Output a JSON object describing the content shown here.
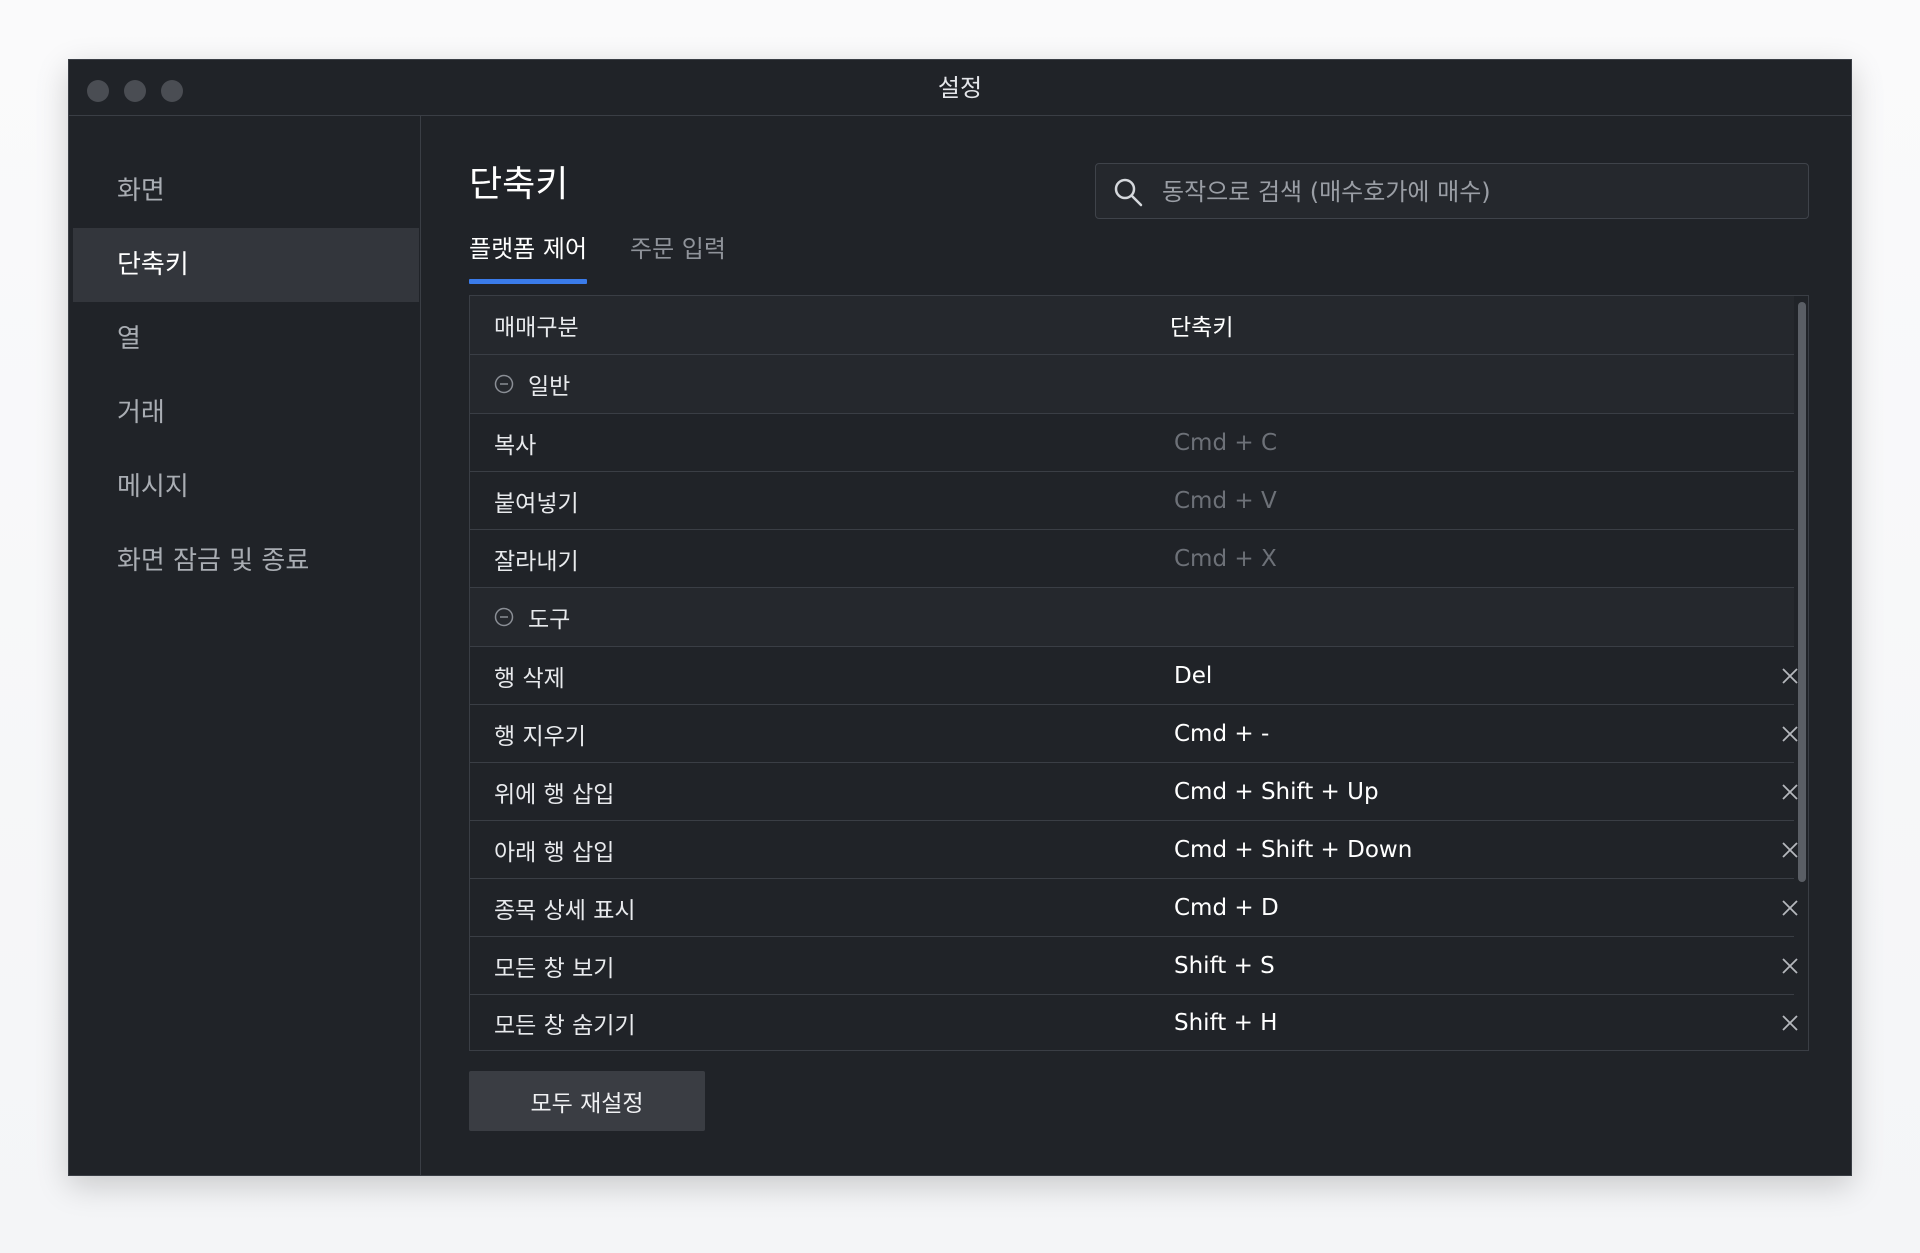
{
  "window": {
    "title": "설정"
  },
  "sidebar": {
    "items": [
      {
        "label": "화면",
        "active": false
      },
      {
        "label": "단축키",
        "active": true
      },
      {
        "label": "열",
        "active": false
      },
      {
        "label": "거래",
        "active": false
      },
      {
        "label": "메시지",
        "active": false
      },
      {
        "label": "화면 잠금 및 종료",
        "active": false
      }
    ]
  },
  "main": {
    "title": "단축키",
    "search": {
      "placeholder": "동작으로 검색 (매수호가에 매수)",
      "value": "",
      "icon": "search-icon"
    },
    "tabs": [
      {
        "label": "플랫폼 제어",
        "active": true
      },
      {
        "label": "주문 입력",
        "active": false
      }
    ],
    "table": {
      "columns": [
        "매매구분",
        "단축키"
      ],
      "groups": [
        {
          "name": "일반",
          "icon": "collapse-icon",
          "rows": [
            {
              "action": "복사",
              "shortcut": "Cmd + C",
              "editable": false
            },
            {
              "action": "붙여넣기",
              "shortcut": "Cmd + V",
              "editable": false
            },
            {
              "action": "잘라내기",
              "shortcut": "Cmd + X",
              "editable": false
            }
          ]
        },
        {
          "name": "도구",
          "icon": "collapse-icon",
          "rows": [
            {
              "action": "행 삭제",
              "shortcut": "Del",
              "editable": true
            },
            {
              "action": "행 지우기",
              "shortcut": "Cmd + -",
              "editable": true
            },
            {
              "action": "위에 행 삽입",
              "shortcut": "Cmd + Shift + Up",
              "editable": true
            },
            {
              "action": "아래 행 삽입",
              "shortcut": "Cmd + Shift + Down",
              "editable": true
            },
            {
              "action": "종목 상세 표시",
              "shortcut": "Cmd + D",
              "editable": true
            },
            {
              "action": "모든 창 보기",
              "shortcut": "Shift + S",
              "editable": true
            },
            {
              "action": "모든 창 숨기기",
              "shortcut": "Shift + H",
              "editable": true
            }
          ]
        }
      ]
    },
    "reset_button": "모두 재설정"
  },
  "colors": {
    "window_bg": "#202328",
    "accent": "#3a7bea",
    "active_sidebar_bg": "#33363c",
    "muted_text": "#6d7178"
  }
}
